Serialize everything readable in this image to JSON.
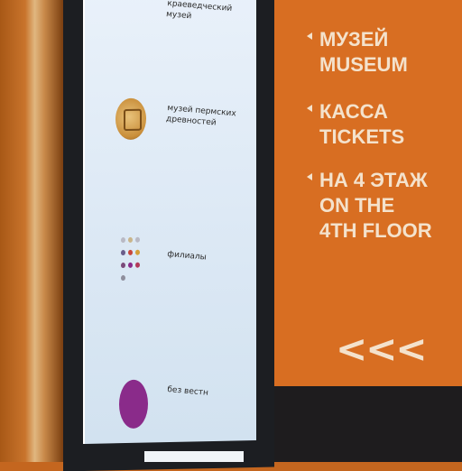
{
  "kiosk": {
    "items": [
      {
        "label": "краеведческий музей"
      },
      {
        "label": "музей пермских древностей"
      },
      {
        "label": "филиалы"
      },
      {
        "label": "без вестн"
      }
    ]
  },
  "sign": {
    "rows": [
      {
        "line1": "МУЗЕЙ",
        "line2": "MUSEUM"
      },
      {
        "line1": "КАССА",
        "line2": "TICKETS"
      },
      {
        "line1": "НА 4 ЭТАЖ",
        "line2": "ON THE",
        "line3": "4TH FLOOR"
      }
    ],
    "chevrons": "<<<"
  },
  "colors": {
    "sign_orange": "#d86e22",
    "sign_text": "#f4e2cc",
    "screen_bg": "#e9f1fa",
    "purple": "#8a2b8a"
  }
}
